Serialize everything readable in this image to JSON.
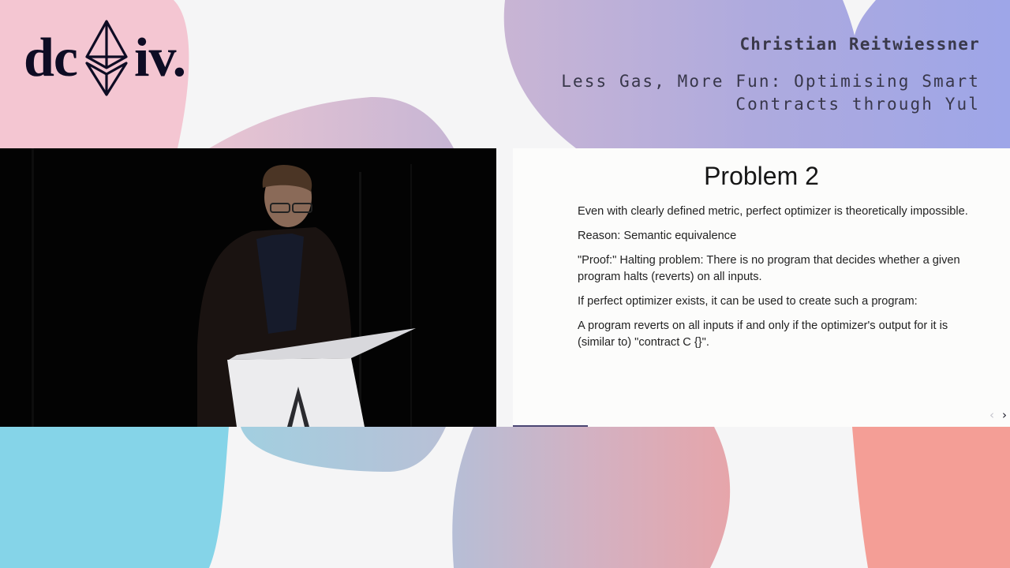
{
  "branding": {
    "logo_left": "dc",
    "logo_right": "iv.",
    "logo_icon": "ethereum-diamond-icon"
  },
  "header": {
    "speaker": "Christian Reitwiessner",
    "talk_title": "Less Gas, More Fun: Optimising Smart\nContracts through Yul"
  },
  "video": {
    "description": "Speaker at podium with laptop, dark stage background"
  },
  "slide": {
    "title": "Problem 2",
    "paragraphs": [
      "Even with clearly defined metric, perfect optimizer is theoretically impossible.",
      "Reason: Semantic equivalence",
      "\"Proof:\" Halting problem: There is no program that decides whether a given program halts (reverts) on all inputs.",
      "If perfect optimizer exists, it can be used to create such a program:",
      "A program reverts on all inputs if and only if the optimizer's output for it is (similar to) \"contract C {}\"."
    ],
    "nav": {
      "prev": "‹",
      "next": "›"
    },
    "progress": 0.15
  },
  "colors": {
    "background": "#f5f5f6",
    "text_dark": "#0e0c24",
    "blob_pink": "#f4c6d2",
    "blob_lavender": "#c2b3d6",
    "blob_periwinkle": "#a1a6e6",
    "blob_cyan": "#85d4e8",
    "blob_coral": "#f49e96",
    "progress": "#4a4673"
  }
}
